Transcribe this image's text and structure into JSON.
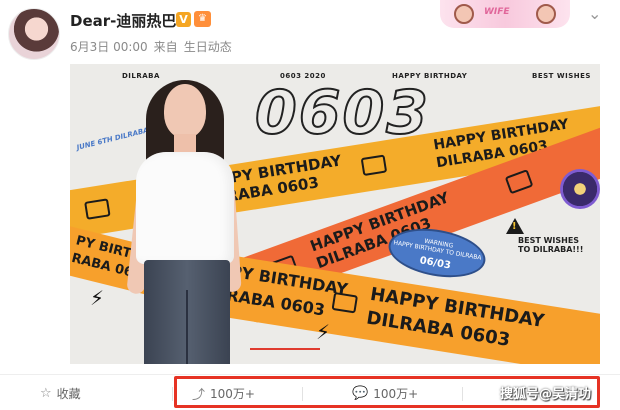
{
  "post": {
    "username": "Dear-迪丽热巴",
    "verified_badge": "V",
    "date": "6月3日 00:00",
    "source_prefix": "来自",
    "source": "生日动态"
  },
  "header_decoration": {
    "text": "WIFE"
  },
  "poster": {
    "top_labels": [
      "DILRABA",
      "0603 2020",
      "HAPPY BIRTHDAY",
      "BEST WISHES"
    ],
    "big_number": "0603",
    "ribbon_line1": "HAPPY BIRTHDAY",
    "ribbon_line2": "DILRABA 0603",
    "ribbon_short": "PY BIRTHDAY",
    "ribbon_short2": "RABA 0603",
    "sticker_warning": "WARNING",
    "sticker_warning_sub": "HAPPY BIRTHDAY TO DILRABA",
    "sticker_date": "06/03",
    "best_wishes_1": "BEST WISHES",
    "best_wishes_2": "TO DILRABA!!!",
    "side_note": "JUNE 6TH DILRABA"
  },
  "footer": {
    "favorite_label": "收藏",
    "share_count": "100万+",
    "comment_count": "100万+",
    "watermark": "搜狐号@吴清功"
  },
  "colors": {
    "yellow_ribbon": "#f4ac2a",
    "red_ribbon": "#f06a37",
    "highlight_box": "#e63324"
  }
}
